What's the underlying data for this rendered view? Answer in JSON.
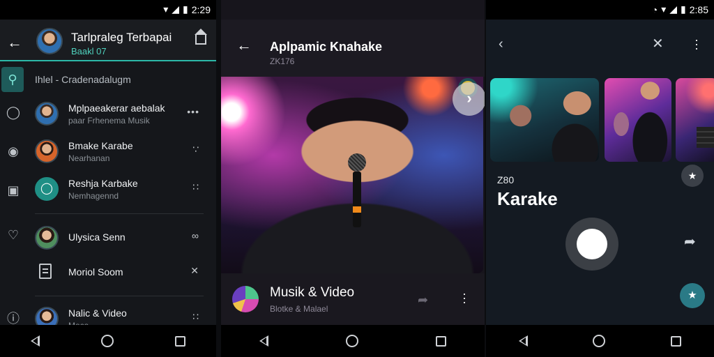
{
  "left": {
    "status": {
      "time": "2:29"
    },
    "header": {
      "title": "Tarlpraleg Terbapai",
      "subtitle": "Baakl 07"
    },
    "search_text": "Ihlel - Cradenadalugm",
    "items": [
      {
        "title": "Mplpaeakerar aebalak",
        "subtitle": "paar Frhenema Musik",
        "action": "•••"
      },
      {
        "title": "Bmake Karabe",
        "subtitle": "Nearhanan",
        "action": "∵"
      },
      {
        "title": "Reshja Karbake",
        "subtitle": "Nemhagennd",
        "action": "∷"
      },
      {
        "title": "Ulysica Senn",
        "subtitle": "",
        "action": "∞"
      },
      {
        "title": "Moriol Soom",
        "subtitle": "",
        "action": "✕"
      },
      {
        "title": "Nalic & Video",
        "subtitle": "Moca",
        "action": "∷"
      }
    ]
  },
  "middle": {
    "header": {
      "title": "Aplpamic Knahake",
      "subtitle": "ZK176"
    },
    "footer": {
      "title": "Musik & Video",
      "subtitle": "Blotke & Malael"
    }
  },
  "right": {
    "status": {
      "time": "2:85"
    },
    "count": "Z80",
    "title": "Karake"
  }
}
